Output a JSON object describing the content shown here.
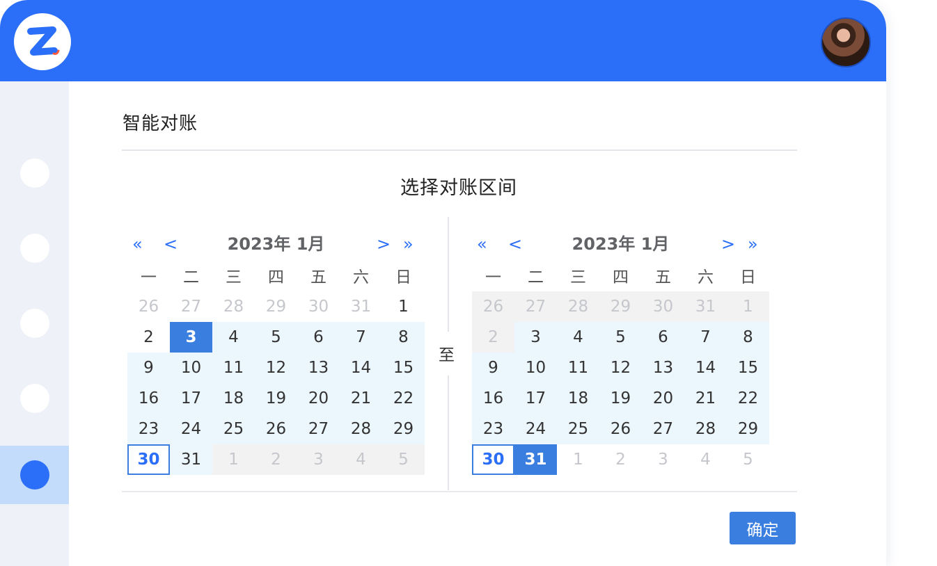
{
  "app": {
    "logo_icon": "z-logo-icon",
    "avatar_icon": "user-avatar-icon",
    "brand_color": "#2b6ef7"
  },
  "page": {
    "title": "智能对账",
    "section_title": "选择对账区间",
    "to_label": "至",
    "confirm_label": "确定"
  },
  "sidebar": {
    "items": 5,
    "active_index": 4
  },
  "calendars": [
    {
      "month_label": "2023年  1月",
      "prev_year": "«",
      "prev_month": "<",
      "next_month": ">",
      "next_year": "»",
      "weekdays": [
        "一",
        "二",
        "三",
        "四",
        "五",
        "六",
        "日"
      ],
      "days": [
        [
          "26",
          "other"
        ],
        [
          "27",
          "other"
        ],
        [
          "28",
          "other"
        ],
        [
          "29",
          "other"
        ],
        [
          "30",
          "other"
        ],
        [
          "31",
          "other"
        ],
        [
          "1",
          ""
        ],
        [
          "2",
          ""
        ],
        [
          "3",
          "selected"
        ],
        [
          "4",
          "inrange"
        ],
        [
          "5",
          "inrange"
        ],
        [
          "6",
          "inrange"
        ],
        [
          "7",
          "inrange"
        ],
        [
          "8",
          "inrange"
        ],
        [
          "9",
          "inrange"
        ],
        [
          "10",
          "inrange"
        ],
        [
          "11",
          "inrange"
        ],
        [
          "12",
          "inrange"
        ],
        [
          "13",
          "inrange"
        ],
        [
          "14",
          "inrange"
        ],
        [
          "15",
          "inrange"
        ],
        [
          "16",
          "inrange"
        ],
        [
          "17",
          "inrange"
        ],
        [
          "18",
          "inrange"
        ],
        [
          "19",
          "inrange"
        ],
        [
          "20",
          "inrange"
        ],
        [
          "21",
          "inrange"
        ],
        [
          "22",
          "inrange"
        ],
        [
          "23",
          "inrange"
        ],
        [
          "24",
          "inrange"
        ],
        [
          "25",
          "inrange"
        ],
        [
          "26",
          "inrange"
        ],
        [
          "27",
          "inrange"
        ],
        [
          "28",
          "inrange"
        ],
        [
          "29",
          "inrange"
        ],
        [
          "30",
          "today"
        ],
        [
          "31",
          "inrange"
        ],
        [
          "1",
          "disabled"
        ],
        [
          "2",
          "disabled"
        ],
        [
          "3",
          "disabled"
        ],
        [
          "4",
          "disabled"
        ],
        [
          "5",
          "disabled"
        ]
      ]
    },
    {
      "month_label": "2023年  1月",
      "prev_year": "«",
      "prev_month": "<",
      "next_month": ">",
      "next_year": "»",
      "weekdays": [
        "一",
        "二",
        "三",
        "四",
        "五",
        "六",
        "日"
      ],
      "days": [
        [
          "26",
          "disabled"
        ],
        [
          "27",
          "disabled"
        ],
        [
          "28",
          "disabled"
        ],
        [
          "29",
          "disabled"
        ],
        [
          "30",
          "disabled"
        ],
        [
          "31",
          "disabled"
        ],
        [
          "1",
          "disabled"
        ],
        [
          "2",
          "disabled"
        ],
        [
          "3",
          "inrange"
        ],
        [
          "4",
          "inrange"
        ],
        [
          "5",
          "inrange"
        ],
        [
          "6",
          "inrange"
        ],
        [
          "7",
          "inrange"
        ],
        [
          "8",
          "inrange"
        ],
        [
          "9",
          "inrange"
        ],
        [
          "10",
          "inrange"
        ],
        [
          "11",
          "inrange"
        ],
        [
          "12",
          "inrange"
        ],
        [
          "13",
          "inrange"
        ],
        [
          "14",
          "inrange"
        ],
        [
          "15",
          "inrange"
        ],
        [
          "16",
          "inrange"
        ],
        [
          "17",
          "inrange"
        ],
        [
          "18",
          "inrange"
        ],
        [
          "19",
          "inrange"
        ],
        [
          "20",
          "inrange"
        ],
        [
          "21",
          "inrange"
        ],
        [
          "22",
          "inrange"
        ],
        [
          "23",
          "inrange"
        ],
        [
          "24",
          "inrange"
        ],
        [
          "25",
          "inrange"
        ],
        [
          "26",
          "inrange"
        ],
        [
          "27",
          "inrange"
        ],
        [
          "28",
          "inrange"
        ],
        [
          "29",
          "inrange"
        ],
        [
          "30",
          "today"
        ],
        [
          "31",
          "selected"
        ],
        [
          "1",
          "other"
        ],
        [
          "2",
          "other"
        ],
        [
          "3",
          "other"
        ],
        [
          "4",
          "other"
        ],
        [
          "5",
          "other"
        ]
      ]
    }
  ]
}
